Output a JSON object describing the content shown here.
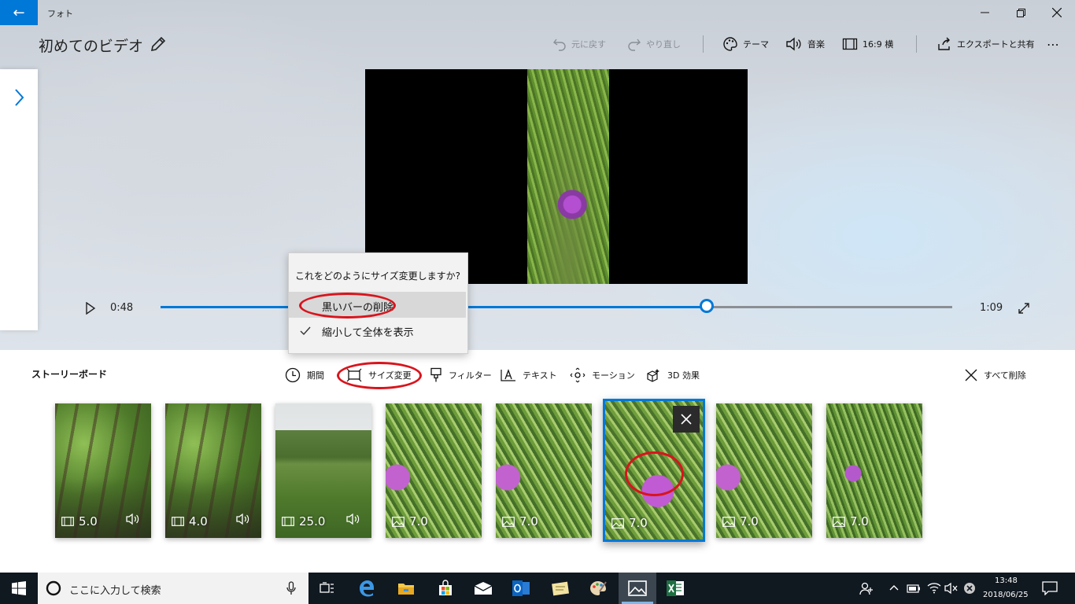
{
  "window": {
    "app_name": "フォト",
    "back": "←",
    "minimize": "—",
    "restore": "❐",
    "close": "✕"
  },
  "header": {
    "title": "初めてのビデオ",
    "undo": "元に戻す",
    "redo": "やり直し",
    "theme": "テーマ",
    "music": "音楽",
    "aspect": "16:9 横",
    "export": "エクスポートと共有",
    "more": "⋯"
  },
  "playback": {
    "current_time": "0:48",
    "total_time": "1:09",
    "progress_fraction": 0.69
  },
  "resize_menu": {
    "heading": "これをどのようにサイズ変更しますか?",
    "options": [
      {
        "label": "黒いバーの削除",
        "checked": false,
        "highlighted": true
      },
      {
        "label": "縮小して全体を表示",
        "checked": true,
        "highlighted": false
      }
    ]
  },
  "storyboard": {
    "label": "ストーリーボード",
    "tools": [
      {
        "label": "期間",
        "icon": "clock-icon"
      },
      {
        "label": "サイズ変更",
        "icon": "resize-icon"
      },
      {
        "label": "フィルター",
        "icon": "filter-icon"
      },
      {
        "label": "テキスト",
        "icon": "text-icon"
      },
      {
        "label": "モーション",
        "icon": "motion-icon"
      },
      {
        "label": "3D 効果",
        "icon": "3d-effects-icon"
      }
    ],
    "remove_all": "すべて削除",
    "clips": [
      {
        "type": "video",
        "duration": "5.0",
        "audio": true,
        "image": "trees"
      },
      {
        "type": "video",
        "duration": "4.0",
        "audio": true,
        "image": "trees"
      },
      {
        "type": "video",
        "duration": "25.0",
        "audio": true,
        "image": "field"
      },
      {
        "type": "photo",
        "duration": "7.0",
        "audio": false,
        "image": "thistle"
      },
      {
        "type": "photo",
        "duration": "7.0",
        "audio": false,
        "image": "thistle"
      },
      {
        "type": "photo",
        "duration": "7.0",
        "audio": false,
        "image": "thistle-center",
        "selected": true
      },
      {
        "type": "photo",
        "duration": "7.0",
        "audio": false,
        "image": "thistle"
      },
      {
        "type": "photo",
        "duration": "7.0",
        "audio": false,
        "image": "thistle-small"
      }
    ]
  },
  "taskbar": {
    "search_placeholder": "ここに入力して検索",
    "time": "13:48",
    "date": "2018/06/25"
  },
  "colors": {
    "accent": "#0078d7",
    "annotation_red": "#d9141c",
    "taskbar": "#101820"
  }
}
